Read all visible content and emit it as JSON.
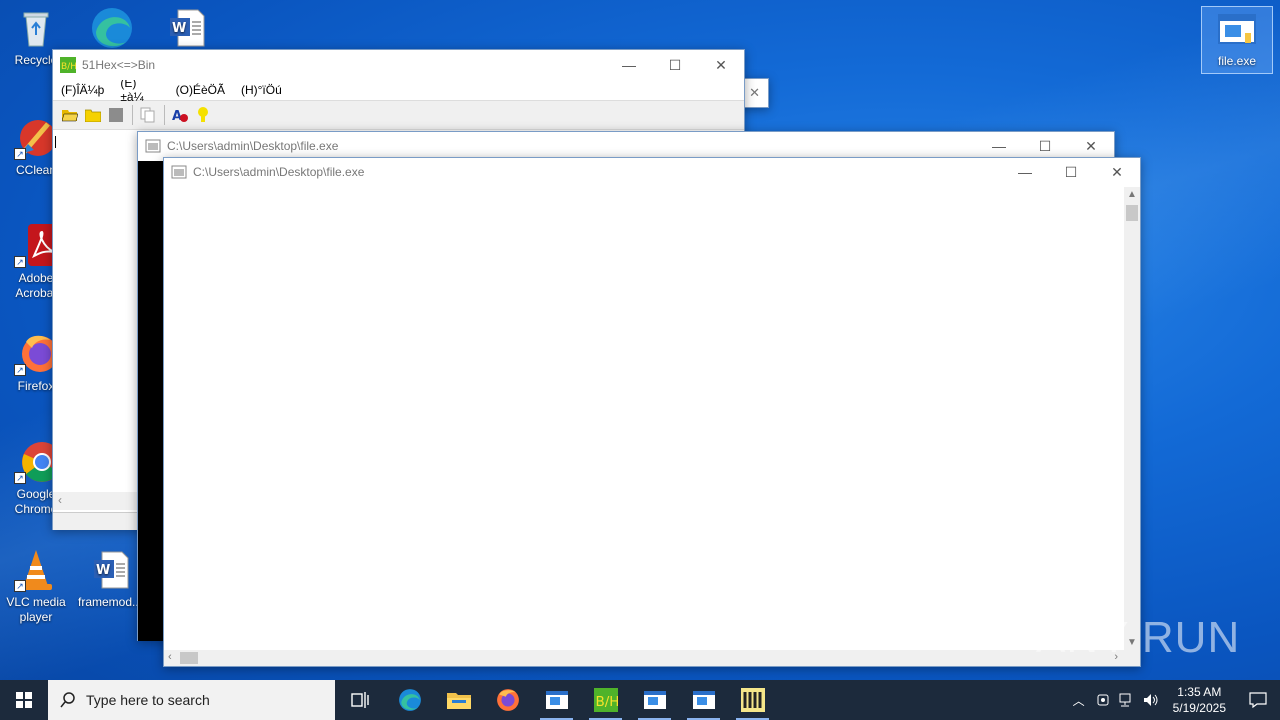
{
  "desktop_icons": [
    {
      "id": "recycle",
      "label": "Recycle"
    },
    {
      "id": "edge",
      "label": ""
    },
    {
      "id": "word",
      "label": ""
    },
    {
      "id": "ccleaner",
      "label": "CClean"
    },
    {
      "id": "acrobat",
      "label": "Adobe Acrobat"
    },
    {
      "id": "firefox",
      "label": "Firefox"
    },
    {
      "id": "chrome",
      "label": "Google Chrome"
    },
    {
      "id": "vlc",
      "label": "VLC media player"
    },
    {
      "id": "framemod",
      "label": "framemod..."
    },
    {
      "id": "fileexe",
      "label": "file.exe"
    }
  ],
  "hex_window": {
    "title": "51Hex<=>Bin",
    "menu": [
      "(F)ÎÄ¼þ",
      "(E)±à¼­",
      "(O)ÉèÖÃ",
      "(H)°ïÖú"
    ]
  },
  "console_window_back": {
    "title": "C:\\Users\\admin\\Desktop\\file.exe"
  },
  "console_window_front": {
    "title": "C:\\Users\\admin\\Desktop\\file.exe"
  },
  "taskbar": {
    "search_placeholder": "Type here to search",
    "time": "1:35 AM",
    "date": "5/19/2025"
  },
  "watermark": "ANY RUN",
  "colors": {
    "accent": "#0078d7",
    "taskbar": "#1c2a3c"
  }
}
